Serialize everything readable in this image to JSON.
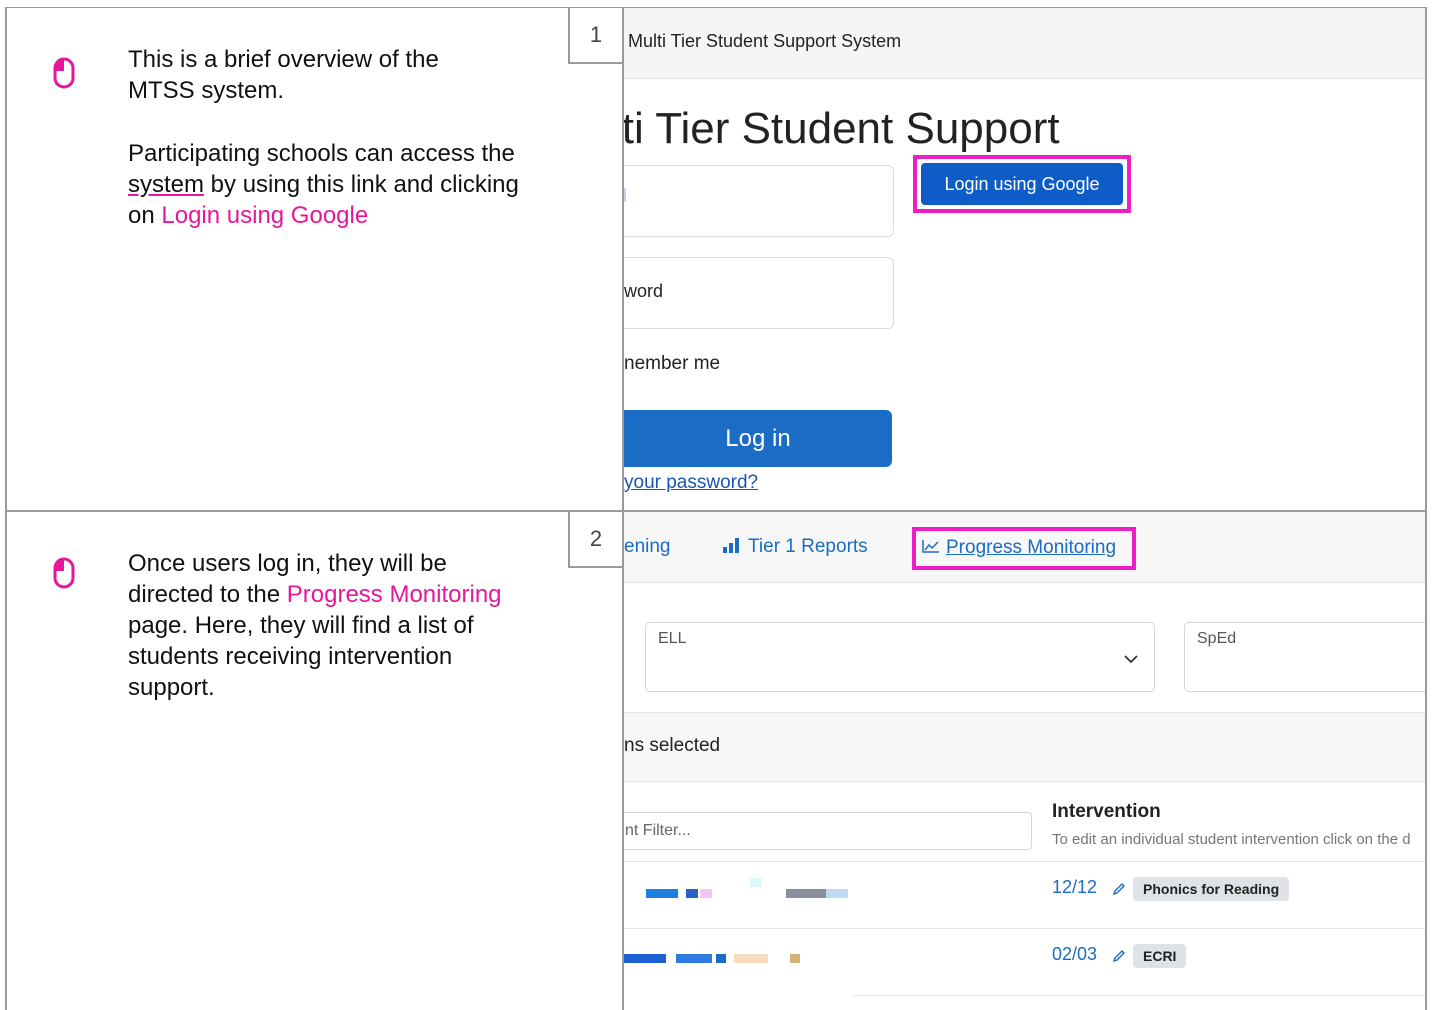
{
  "steps": [
    {
      "number": "1",
      "description": {
        "line1": "This is a brief overview of the MTSS system.",
        "line2_pre": "Participating schools can access the ",
        "line2_link": " system",
        "line2_mid": " by using this link and clicking on ",
        "line2_highlight": "Login using Google"
      },
      "screenshot": {
        "app_title": "\\ Multi Tier Student Support System",
        "heading": "lti Tier Student Support",
        "password_label": "word",
        "remember_label": "nember me",
        "login_button": "Log in",
        "forgot_link": "your password?",
        "google_button": "Login using Google"
      }
    },
    {
      "number": "2",
      "description": {
        "pre": "Once users log in, they will be directed to the ",
        "highlight": "Progress Monitoring",
        "post": " page. Here, they will find a list of students receiving intervention support."
      },
      "screenshot": {
        "nav_screening": "ening",
        "nav_tier1": "Tier 1 Reports",
        "nav_progress": "Progress Monitoring",
        "select_ell": "ELL",
        "select_sped": "SpEd",
        "selection_text": "ns selected",
        "filter_placeholder": "nt Filter...",
        "intervention_header": "Intervention",
        "intervention_sub": "To edit an individual student intervention click on the d",
        "rows": [
          {
            "date": "12/12",
            "badge": "Phonics for Reading"
          },
          {
            "date": "02/03",
            "badge": "ECRI"
          }
        ]
      }
    }
  ],
  "colors": {
    "highlight": "#e6179a",
    "callout_border": "#ee1ec6",
    "primary_button": "#1a6cc4",
    "google_button": "#0d5cc7",
    "link": "#1a6cc4"
  },
  "icons": [
    "mouse-click-icon",
    "bar-chart-icon",
    "line-chart-icon",
    "chevron-down-icon",
    "pencil-icon"
  ]
}
